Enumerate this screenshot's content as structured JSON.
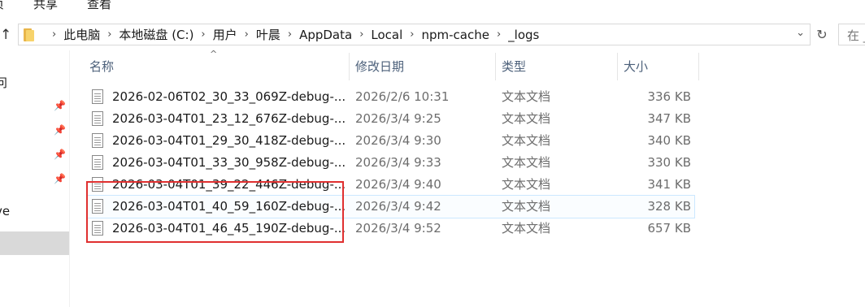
{
  "ribbon": {
    "tabs": [
      "页",
      "共享",
      "查看"
    ]
  },
  "address_bar": {
    "breadcrumbs": [
      "此电脑",
      "本地磁盘 (C:)",
      "用户",
      "叶晨",
      "AppData",
      "Local",
      "npm-cache",
      "_logs"
    ],
    "search_placeholder": "在 _"
  },
  "nav_pane": {
    "partial_label_a": "问",
    "partial_label_b": "ve"
  },
  "file_list": {
    "columns": {
      "name": "名称",
      "date_modified": "修改日期",
      "type": "类型",
      "size": "大小"
    },
    "rows": [
      {
        "name": "2026-02-06T02_30_33_069Z-debug-...",
        "date": "2026/2/6 10:31",
        "type": "文本文档",
        "size": "336 KB"
      },
      {
        "name": "2026-03-04T01_23_12_676Z-debug-...",
        "date": "2026/3/4 9:25",
        "type": "文本文档",
        "size": "347 KB"
      },
      {
        "name": "2026-03-04T01_29_30_418Z-debug-...",
        "date": "2026/3/4 9:30",
        "type": "文本文档",
        "size": "340 KB"
      },
      {
        "name": "2026-03-04T01_33_30_958Z-debug-...",
        "date": "2026/3/4 9:33",
        "type": "文本文档",
        "size": "330 KB"
      },
      {
        "name": "2026-03-04T01_39_22_446Z-debug-...",
        "date": "2026/3/4 9:40",
        "type": "文本文档",
        "size": "341 KB"
      },
      {
        "name": "2026-03-04T01_40_59_160Z-debug-...",
        "date": "2026/3/4 9:42",
        "type": "文本文档",
        "size": "328 KB"
      },
      {
        "name": "2026-03-04T01_46_45_190Z-debug-...",
        "date": "2026/3/4 9:52",
        "type": "文本文档",
        "size": "657 KB"
      }
    ]
  },
  "colors": {
    "annotation_box": "#e03030",
    "hover_row_border": "#cce8ff",
    "header_text": "#4c607a"
  }
}
